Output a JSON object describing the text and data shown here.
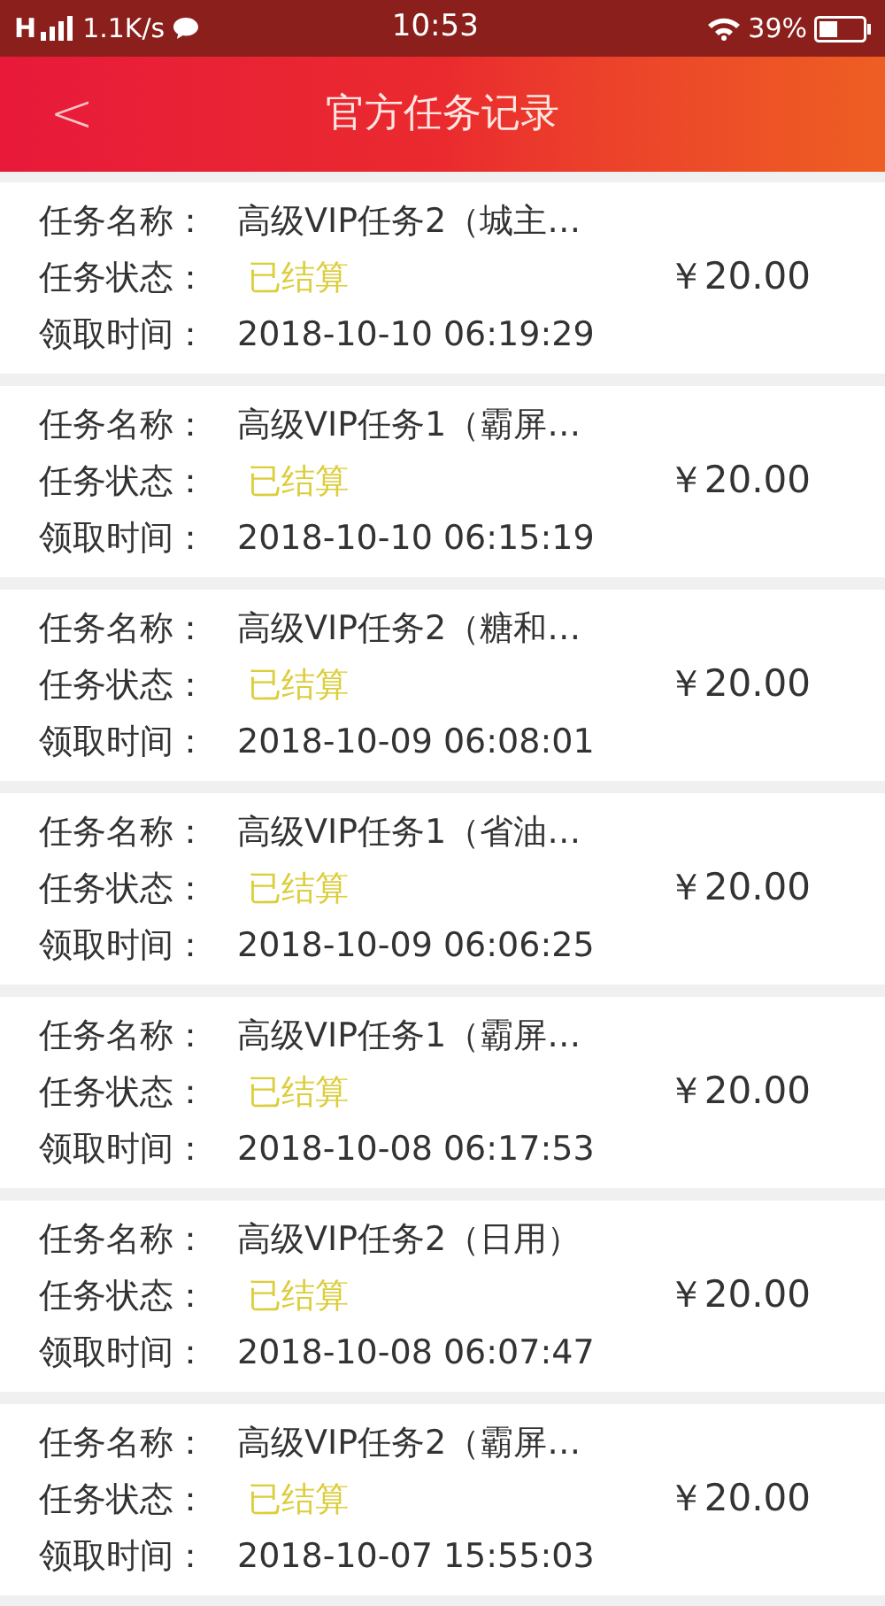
{
  "status_bar": {
    "carrier": "H",
    "speed": "1.1K/s",
    "time": "10:53",
    "battery": "39%"
  },
  "header": {
    "back": "<",
    "title": "官方任务记录"
  },
  "records": [
    {
      "name_label": "任务名称：",
      "name": "高级VIP任务2（城主…",
      "status_label": "任务状态：",
      "status": "已结算",
      "time_label": "领取时间：",
      "time": "2018-10-10 06:19:29",
      "amount": "￥20.00"
    },
    {
      "name_label": "任务名称：",
      "name": "高级VIP任务1（霸屏…",
      "status_label": "任务状态：",
      "status": "已结算",
      "time_label": "领取时间：",
      "time": "2018-10-10 06:15:19",
      "amount": "￥20.00"
    },
    {
      "name_label": "任务名称：",
      "name": "高级VIP任务2（糖和…",
      "status_label": "任务状态：",
      "status": "已结算",
      "time_label": "领取时间：",
      "time": "2018-10-09 06:08:01",
      "amount": "￥20.00"
    },
    {
      "name_label": "任务名称：",
      "name": "高级VIP任务1（省油…",
      "status_label": "任务状态：",
      "status": "已结算",
      "time_label": "领取时间：",
      "time": "2018-10-09 06:06:25",
      "amount": "￥20.00"
    },
    {
      "name_label": "任务名称：",
      "name": "高级VIP任务1（霸屏…",
      "status_label": "任务状态：",
      "status": "已结算",
      "time_label": "领取时间：",
      "time": "2018-10-08 06:17:53",
      "amount": "￥20.00"
    },
    {
      "name_label": "任务名称：",
      "name": "高级VIP任务2（日用）",
      "status_label": "任务状态：",
      "status": "已结算",
      "time_label": "领取时间：",
      "time": "2018-10-08 06:07:47",
      "amount": "￥20.00"
    },
    {
      "name_label": "任务名称：",
      "name": "高级VIP任务2（霸屏…",
      "status_label": "任务状态：",
      "status": "已结算",
      "time_label": "领取时间：",
      "time": "2018-10-07 15:55:03",
      "amount": "￥20.00"
    }
  ]
}
